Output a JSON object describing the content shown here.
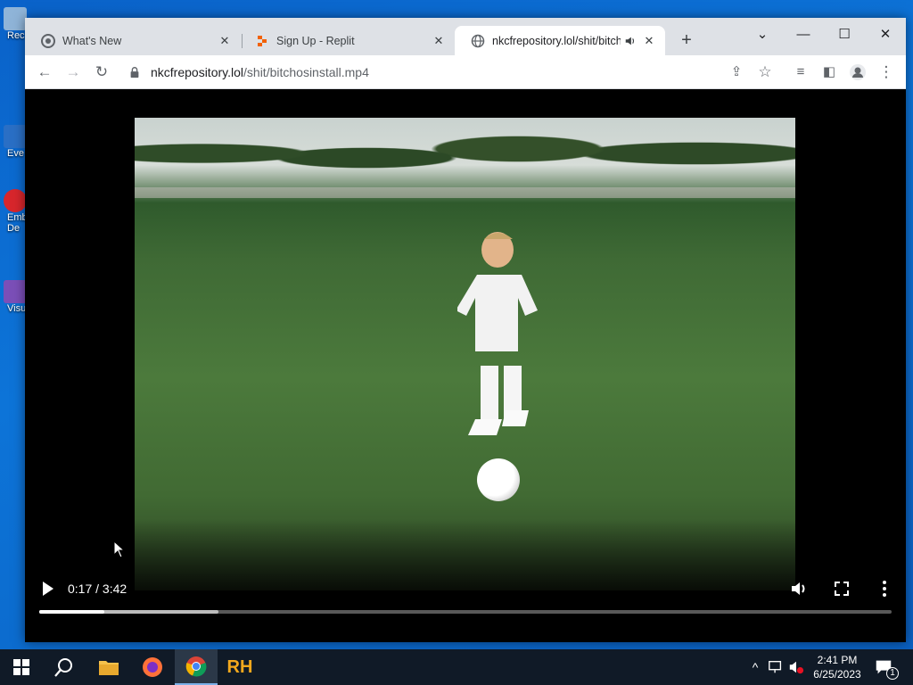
{
  "desktop": {
    "icons": [
      {
        "label": "Rec",
        "color": "#8fb4d8"
      },
      {
        "label": "Eve",
        "color": "#2a6fc5"
      },
      {
        "label": "Emb",
        "sub": "De",
        "color": "#d8262c"
      },
      {
        "label": "Visu",
        "color": "#7b4fb8"
      }
    ]
  },
  "browser": {
    "tabs": [
      {
        "title": "What's New",
        "favicon": "chrome-icon"
      },
      {
        "title": "Sign Up - Replit",
        "favicon": "replit-icon"
      },
      {
        "title": "nkcfrepository.lol/shit/bitchosinstall.mp4",
        "favicon": "globe-icon"
      }
    ],
    "address": {
      "host": "nkcfrepository.lol",
      "path": "/shit/bitchosinstall.mp4"
    }
  },
  "video": {
    "current_time": "0:17",
    "duration": "3:42",
    "time_display": "0:17 / 3:42",
    "played_fraction": 0.0766,
    "buffered_fraction": 0.21
  },
  "taskbar": {
    "clock_time": "2:41 PM",
    "clock_date": "6/25/2023",
    "notification_count": "1",
    "app_rh_label": "RH"
  },
  "colors": {
    "chrome_frame": "#dee1e6",
    "desktop_blue": "#0a62c9",
    "taskbar": "#101a27",
    "replit_orange": "#f26207"
  }
}
